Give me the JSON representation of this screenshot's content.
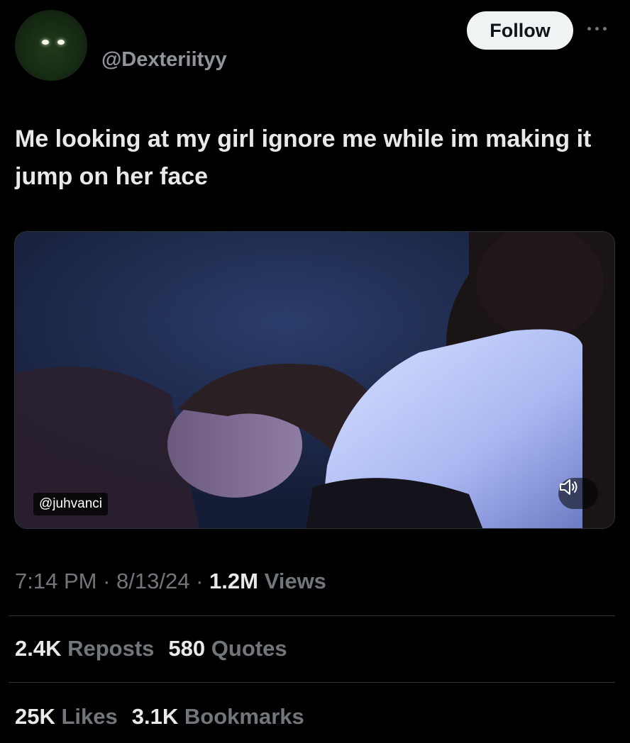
{
  "author": {
    "handle": "@Dexteriityy",
    "follow_label": "Follow"
  },
  "tweet": {
    "text": "Me looking at my girl ignore me while im making it jump on her face"
  },
  "media": {
    "watermark": "@juhvanci",
    "volume_icon": "volume-icon"
  },
  "meta": {
    "time": "7:14 PM",
    "date": "8/13/24",
    "separator": "·",
    "views_count": "1.2M",
    "views_label": "Views"
  },
  "stats": {
    "reposts_count": "2.4K",
    "reposts_label": "Reposts",
    "quotes_count": "580",
    "quotes_label": "Quotes",
    "likes_count": "25K",
    "likes_label": "Likes",
    "bookmarks_count": "3.1K",
    "bookmarks_label": "Bookmarks"
  },
  "colors": {
    "background": "#000000",
    "text_primary": "#e7e9ea",
    "text_secondary": "#71767b",
    "follow_bg": "#eff3f4",
    "divider": "#2f3336"
  }
}
